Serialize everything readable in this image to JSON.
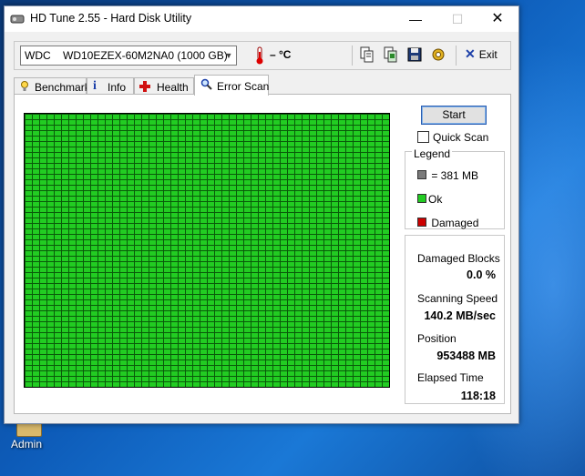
{
  "desktop": {
    "icon_label": "Admin"
  },
  "window": {
    "title": "HD Tune 2.55 - Hard Disk Utility",
    "controls": {
      "minimize": "—",
      "maximize": "☐",
      "close": "✕"
    }
  },
  "toolbar": {
    "drive": "WDC    WD10EZEX-60M2NA0 (1000 GB)",
    "temperature": "– °C",
    "icons": [
      "copy-info-icon",
      "copy-screen-icon",
      "save-icon",
      "options-icon"
    ],
    "exit_label": "Exit"
  },
  "tabs": [
    {
      "label": "Benchmark",
      "icon": "benchmark-icon"
    },
    {
      "label": "Info",
      "icon": "info-icon"
    },
    {
      "label": "Health",
      "icon": "health-icon"
    },
    {
      "label": "Error Scan",
      "icon": "magnifier-icon",
      "active": true
    }
  ],
  "scan": {
    "start_label": "Start",
    "quick_scan_label": "Quick Scan",
    "quick_scan_checked": false,
    "grid_status": "all-ok",
    "grid_color": "#22cc22"
  },
  "legend": {
    "title": "Legend",
    "block": "= 381 MB",
    "ok": "Ok",
    "damaged": "Damaged",
    "colors": {
      "block": "#7a7a7a",
      "ok": "#22cc22",
      "damaged": "#cc0000"
    }
  },
  "stats": {
    "damaged_blocks_label": "Damaged Blocks",
    "damaged_blocks_value": "0.0 %",
    "speed_label": "Scanning Speed",
    "speed_value": "140.2 MB/sec",
    "position_label": "Position",
    "position_value": "953488 MB",
    "elapsed_label": "Elapsed Time",
    "elapsed_value": "118:18"
  }
}
